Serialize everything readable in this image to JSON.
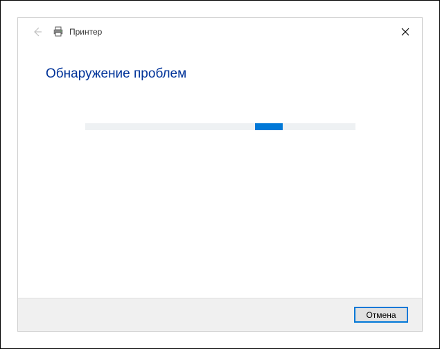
{
  "window": {
    "title": "Принтер"
  },
  "content": {
    "heading": "Обнаружение проблем"
  },
  "footer": {
    "cancel_label": "Отмена"
  }
}
